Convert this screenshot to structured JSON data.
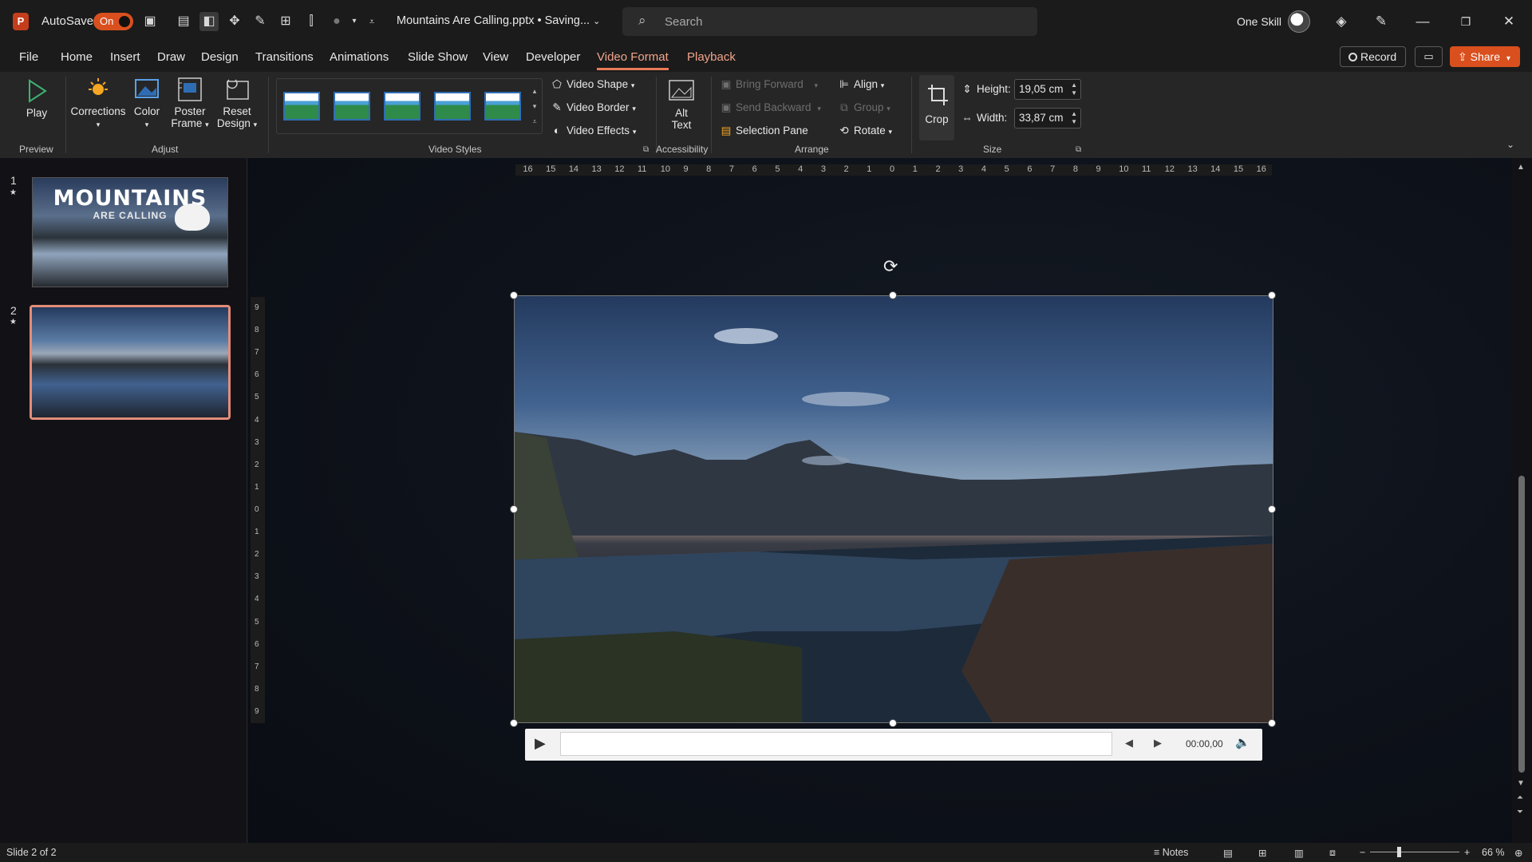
{
  "titlebar": {
    "app_logo": "P",
    "autosave_label": "AutoSave",
    "autosave_state": "On",
    "doc_title": "Mountains Are Calling.pptx • Saving...",
    "search_placeholder": "Search",
    "user_name": "One Skill",
    "accent_color": "#d9501e"
  },
  "menu": {
    "tabs": [
      "File",
      "Home",
      "Insert",
      "Draw",
      "Design",
      "Transitions",
      "Animations",
      "Slide Show",
      "View",
      "Developer",
      "Video Format",
      "Playback"
    ],
    "active_tab": "Video Format",
    "record_label": "Record",
    "share_label": "Share"
  },
  "ribbon": {
    "preview": {
      "play_label": "Play",
      "group_label": "Preview"
    },
    "adjust": {
      "corrections_label": "Corrections",
      "color_label": "Color",
      "poster_label_1": "Poster",
      "poster_label_2": "Frame",
      "reset_label_1": "Reset",
      "reset_label_2": "Design",
      "group_label": "Adjust"
    },
    "video_styles": {
      "shape_label": "Video Shape",
      "border_label": "Video Border",
      "effects_label": "Video Effects",
      "group_label": "Video Styles",
      "style_count": 5
    },
    "accessibility": {
      "alt_label_1": "Alt",
      "alt_label_2": "Text",
      "group_label": "Accessibility"
    },
    "arrange": {
      "bring_forward": "Bring Forward",
      "send_backward": "Send Backward",
      "selection_pane": "Selection Pane",
      "align": "Align",
      "group": "Group",
      "rotate": "Rotate",
      "group_label": "Arrange"
    },
    "size": {
      "crop_label": "Crop",
      "height_label": "Height:",
      "height_value": "19,05 cm",
      "width_label": "Width:",
      "width_value": "33,87 cm",
      "group_label": "Size"
    }
  },
  "slides": [
    {
      "number": "1",
      "title": "MOUNTAINS",
      "subtitle": "ARE CALLING"
    },
    {
      "number": "2"
    }
  ],
  "ruler": {
    "horizontal": [
      "16",
      "15",
      "14",
      "13",
      "12",
      "11",
      "10",
      "9",
      "8",
      "7",
      "6",
      "5",
      "4",
      "3",
      "2",
      "1",
      "0",
      "1",
      "2",
      "3",
      "4",
      "5",
      "6",
      "7",
      "8",
      "9",
      "10",
      "11",
      "12",
      "13",
      "14",
      "15",
      "16"
    ],
    "vertical": [
      "9",
      "8",
      "7",
      "6",
      "5",
      "4",
      "3",
      "2",
      "1",
      "0",
      "1",
      "2",
      "3",
      "4",
      "5",
      "6",
      "7",
      "8",
      "9"
    ]
  },
  "player": {
    "time": "00:00,00"
  },
  "status": {
    "slide_info": "Slide 2 of 2",
    "notes_label": "Notes",
    "zoom": "66 %"
  }
}
